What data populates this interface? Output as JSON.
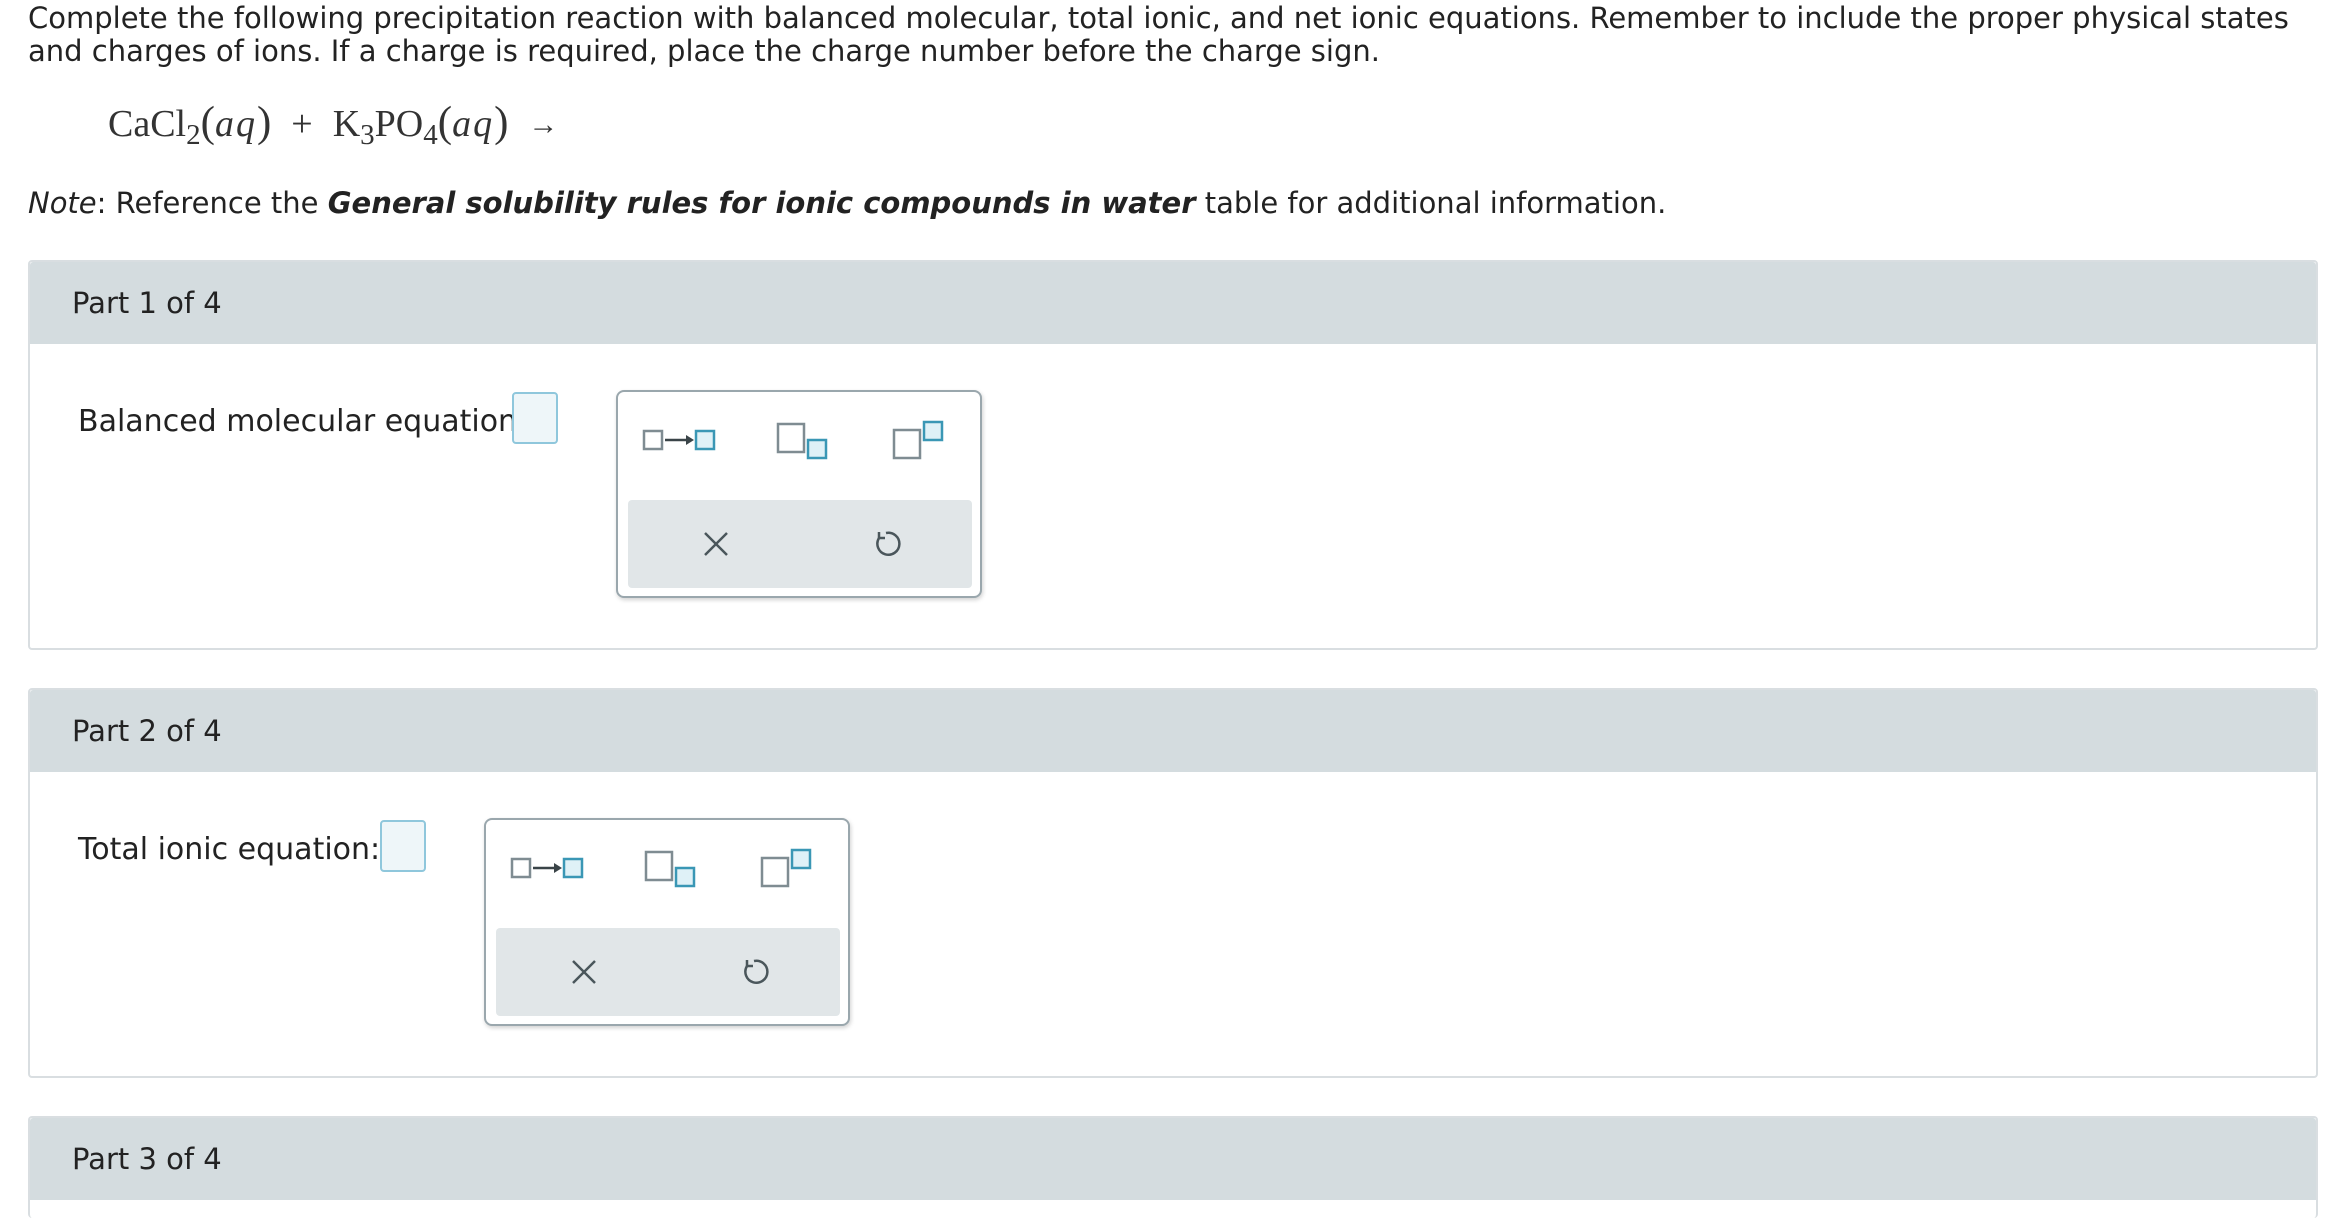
{
  "instructions": "Complete the following precipitation reaction with balanced molecular, total ionic, and net ionic equations. Remember to include the proper physical states and charges of ions. If a charge is required, place the charge number before the charge sign.",
  "equation": {
    "r1": "CaCl",
    "r1_sub": "2",
    "state1": "aq",
    "plus": "+",
    "r2a": "K",
    "r2a_sub": "3",
    "r2b": "PO",
    "r2b_sub": "4",
    "state2": "aq",
    "arrow": "→"
  },
  "note": {
    "prefix": "Note",
    "text1": ": Reference the ",
    "bold": "General solubility rules for ionic compounds in water",
    "text2": " table for additional information."
  },
  "parts": [
    {
      "header": "Part 1 of 4",
      "label": "Balanced molecular equation:"
    },
    {
      "header": "Part 2 of 4",
      "label": "Total ionic equation:"
    },
    {
      "header": "Part 3 of 4"
    }
  ],
  "palette_tools": [
    "reaction-arrow-icon",
    "subscript-icon",
    "superscript-icon",
    "clear-icon",
    "undo-icon"
  ],
  "colors": {
    "box_border": "#8fc7dc",
    "box_fill": "#eef6f9",
    "header_bg": "#d4dcdf"
  }
}
